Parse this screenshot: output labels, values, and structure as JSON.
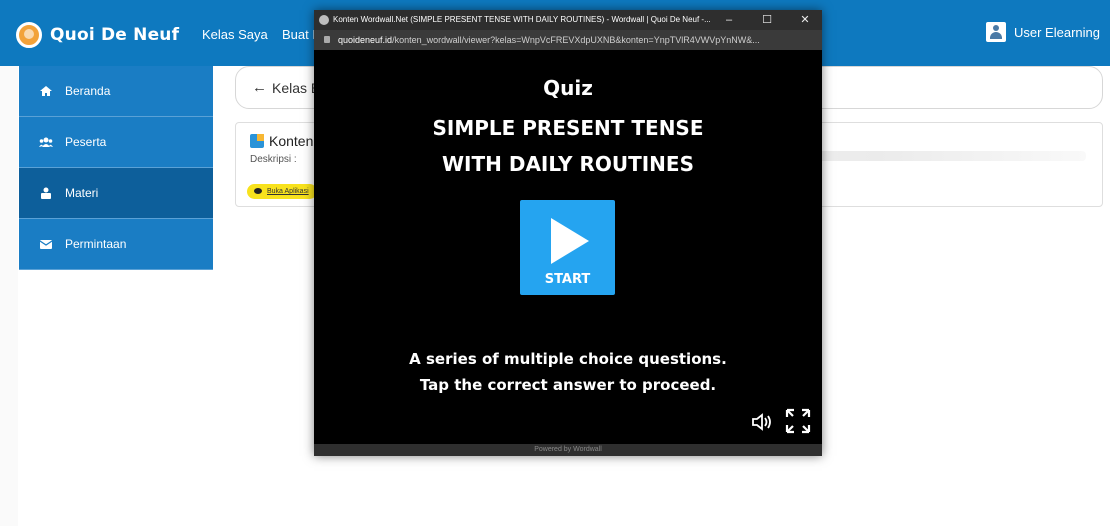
{
  "navbar": {
    "brand": "Quoi De Neuf",
    "links": [
      "Kelas Saya",
      "Buat K"
    ],
    "user": "User Elearning",
    "colors": {
      "navbar": "#0e79bf"
    }
  },
  "sidebar": {
    "items": [
      {
        "label": "Beranda",
        "icon": "home-icon",
        "active": false
      },
      {
        "label": "Peserta",
        "icon": "users-icon",
        "active": false
      },
      {
        "label": "Materi",
        "icon": "materi-icon",
        "active": true
      },
      {
        "label": "Permintaan",
        "icon": "envelope-icon",
        "active": false
      }
    ]
  },
  "main": {
    "back_arrow": "←",
    "back_label": "Kelas B",
    "card": {
      "title": "Konten",
      "description": "Deskripsi :",
      "button": "Buka Aplikasi"
    }
  },
  "popup": {
    "title": "Konten Wordwall.Net (SIMPLE PRESENT TENSE WITH DAILY ROUTINES) - Wordwall | Quoi De Neuf -...",
    "url_host": "quoideneuf.id",
    "url_path": "/konten_wordwall/viewer?kelas=WnpVcFREVXdpUXNB&konten=YnpTVlR4VWVpYnNW&...",
    "window_buttons": [
      "–",
      "☐",
      "✕"
    ],
    "quiz": {
      "label": "Quiz",
      "title_line1": "SIMPLE PRESENT TENSE",
      "title_line2": "WITH DAILY ROUTINES",
      "start": "START",
      "desc_line1": "A series of multiple choice questions.",
      "desc_line2": "Tap the correct answer to proceed.",
      "sound_icon": "speaker-icon",
      "fullscreen_icon": "fullscreen-icon",
      "powered": "Powered by Wordwall"
    }
  }
}
